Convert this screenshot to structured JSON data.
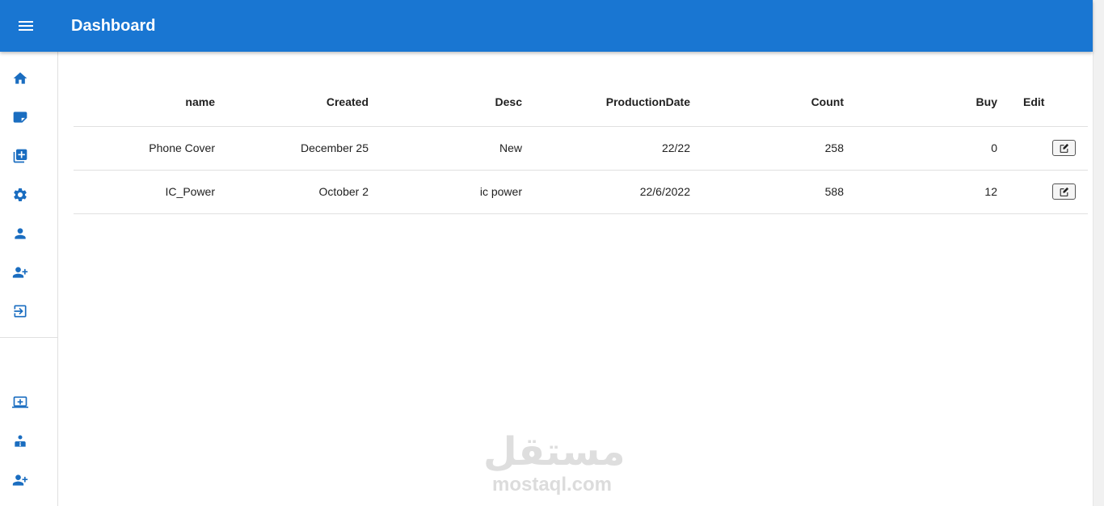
{
  "appbar": {
    "title": "Dashboard",
    "menu_icon": "menu-icon",
    "color": "#1976d2"
  },
  "sidebar": {
    "icon_color": "#1a6dc0",
    "top_items": [
      {
        "name": "home",
        "icon": "home-icon"
      },
      {
        "name": "notes",
        "icon": "note-icon"
      },
      {
        "name": "add-library",
        "icon": "library-add-icon"
      },
      {
        "name": "settings",
        "icon": "gear-icon"
      },
      {
        "name": "profile",
        "icon": "person-icon"
      },
      {
        "name": "add-user",
        "icon": "person-add-icon"
      },
      {
        "name": "logout",
        "icon": "logout-icon"
      }
    ],
    "bottom_items": [
      {
        "name": "add-device",
        "icon": "laptop-add-icon"
      },
      {
        "name": "team",
        "icon": "group-icon"
      },
      {
        "name": "add-member",
        "icon": "person-add-icon"
      }
    ]
  },
  "table": {
    "columns": [
      "name",
      "Created",
      "Desc",
      "ProductionDate",
      "Count",
      "Buy",
      "Edit"
    ],
    "rows": [
      {
        "name": "Phone Cover",
        "created": "December 25",
        "desc": "New",
        "production_date": "22/22",
        "count": "258",
        "buy": "0"
      },
      {
        "name": "IC_Power",
        "created": "October 2",
        "desc": "ic power",
        "production_date": "22/6/2022",
        "count": "588",
        "buy": "12"
      }
    ],
    "edit_icon": "edit-icon"
  },
  "watermark": {
    "arabic": "مستقل",
    "latin": "mostaql.com"
  }
}
